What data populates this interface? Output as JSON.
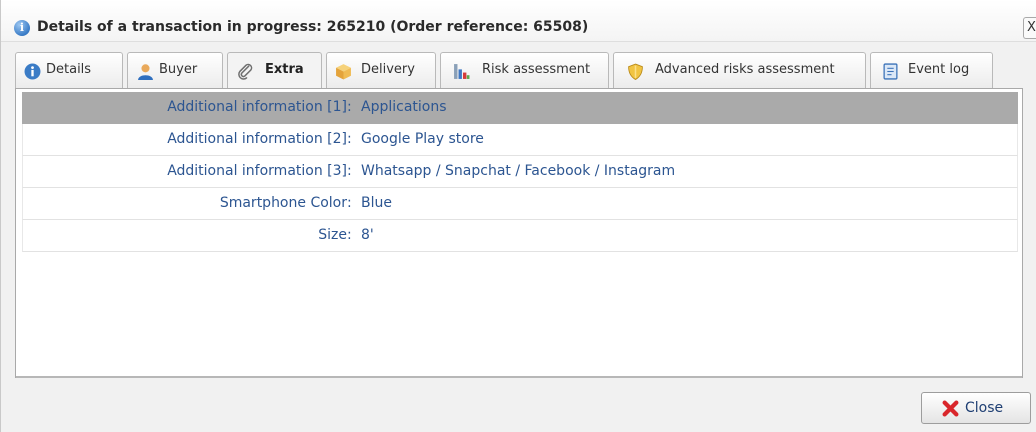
{
  "window": {
    "title": "Details of a transaction in progress: 265210 (Order reference: 65508)",
    "title_icon": "info-icon",
    "close_glyph": "X"
  },
  "tabs": [
    {
      "label": "Details",
      "icon": "info-icon",
      "active": false
    },
    {
      "label": "Buyer",
      "icon": "user-icon",
      "active": false
    },
    {
      "label": "Extra",
      "icon": "paperclip-icon",
      "active": true
    },
    {
      "label": "Delivery",
      "icon": "box-icon",
      "active": false
    },
    {
      "label": "Risk assessment",
      "icon": "chart-icon",
      "active": false
    },
    {
      "label": "Advanced risks assessment",
      "icon": "shield-icon",
      "active": false
    },
    {
      "label": "Event log",
      "icon": "log-icon",
      "active": false
    }
  ],
  "extra_fields": [
    {
      "key": "Additional information [1]",
      "separator": ":",
      "value": "Applications",
      "selected": true
    },
    {
      "key": "Additional information [2]",
      "separator": ":",
      "value": "Google Play store",
      "selected": false
    },
    {
      "key": "Additional information [3]",
      "separator": ":",
      "value": "Whatsapp / Snapchat / Facebook / Instagram",
      "selected": false
    },
    {
      "key": "Smartphone Color",
      "separator": ":",
      "value": "Blue",
      "selected": false
    },
    {
      "key": "Size",
      "separator": ":",
      "value": "8'",
      "selected": false
    }
  ],
  "footer": {
    "close_label": "Close",
    "close_icon": "red-x-icon"
  },
  "colors": {
    "text_blue": "#2c5591",
    "selected_row": "#aaaaaa",
    "close_icon_red": "#d9262b"
  }
}
